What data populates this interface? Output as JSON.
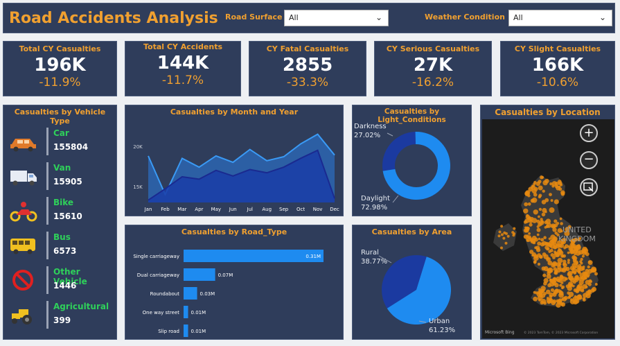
{
  "header": {
    "title": "Road Accidents Analysis",
    "filters": [
      {
        "label": "Road Surface",
        "value": "All"
      },
      {
        "label": "Weather Condition",
        "value": "All"
      }
    ]
  },
  "kpis": [
    {
      "title": "Total CY Casualties",
      "value": "196K",
      "delta": "-11.9%"
    },
    {
      "title": "Total CY Accidents",
      "value": "144K",
      "delta": "-11.7%"
    },
    {
      "title": "CY Fatal Casualties",
      "value": "2855",
      "delta": "-33.3%"
    },
    {
      "title": "CY Serious Casualties",
      "value": "27K",
      "delta": "-16.2%"
    },
    {
      "title": "CY Slight Casualties",
      "value": "166K",
      "delta": "-10.6%"
    }
  ],
  "vehicle": {
    "title": "Casualties by Vehicle Type",
    "items": [
      {
        "name": "Car",
        "value": "155804",
        "icon": "car-icon",
        "color": "#e07a2a"
      },
      {
        "name": "Van",
        "value": "15905",
        "icon": "truck-icon",
        "color": "#ffffff"
      },
      {
        "name": "Bike",
        "value": "15610",
        "icon": "motorbike-icon",
        "color": "#e03030"
      },
      {
        "name": "Bus",
        "value": "6573",
        "icon": "bus-icon",
        "color": "#f0c020"
      },
      {
        "name": "Other Vehicle",
        "value": "1446",
        "icon": "no-entry-icon",
        "color": "#e02020"
      },
      {
        "name": "Agricultural",
        "value": "399",
        "icon": "tractor-icon",
        "color": "#f0c020"
      }
    ]
  },
  "chart_data": [
    {
      "type": "area",
      "title": "Casualties by Month and Year",
      "categories": [
        "Jan",
        "Feb",
        "Mar",
        "Apr",
        "May",
        "Jun",
        "Jul",
        "Aug",
        "Sep",
        "Oct",
        "Nov",
        "Dec"
      ],
      "yticks": [
        "15K",
        "20K"
      ],
      "ylim": [
        13000,
        22500
      ],
      "series": [
        {
          "values": [
            18800,
            14000,
            18500,
            17400,
            18800,
            18000,
            19600,
            18200,
            18700,
            20300,
            21500,
            18900
          ],
          "color": "#2a7be0"
        },
        {
          "values": [
            13300,
            14700,
            16200,
            15900,
            17000,
            16300,
            17100,
            16700,
            17400,
            18500,
            19500,
            13500
          ],
          "color": "#1a3da8"
        }
      ]
    },
    {
      "type": "bar",
      "title": "Casualties by Road_Type",
      "categories": [
        "Single carriageway",
        "Dual carriageway",
        "Roundabout",
        "One way street",
        "Slip road"
      ],
      "values": [
        0.31,
        0.07,
        0.03,
        0.01,
        0.01
      ],
      "labels": [
        "0.31M",
        "0.07M",
        "0.03M",
        "0.01M",
        "0.01M"
      ],
      "color": "#1e8bf0"
    },
    {
      "type": "pie",
      "title": "Casualties by Light_Conditions",
      "donut": true,
      "slices": [
        {
          "name": "Darkness",
          "value": 27.02,
          "label": "27.02%",
          "color": "#1b3aa0"
        },
        {
          "name": "Daylight",
          "value": 72.98,
          "label": "72.98%",
          "color": "#1e8bf0"
        }
      ]
    },
    {
      "type": "pie",
      "title": "Casualties by Area",
      "donut": false,
      "slices": [
        {
          "name": "Rural",
          "value": 38.77,
          "label": "38.77%",
          "color": "#1b3aa0"
        },
        {
          "name": "Urban",
          "value": 61.23,
          "label": "61.23%",
          "color": "#1e8bf0"
        }
      ]
    }
  ],
  "map": {
    "title": "Casualties by Location",
    "labels": [
      "UNITED",
      "KINGDOM"
    ],
    "attribution": "Microsoft Bing",
    "copyright": "© 2023 TomTom, © 2023 Microsoft Corporation"
  }
}
